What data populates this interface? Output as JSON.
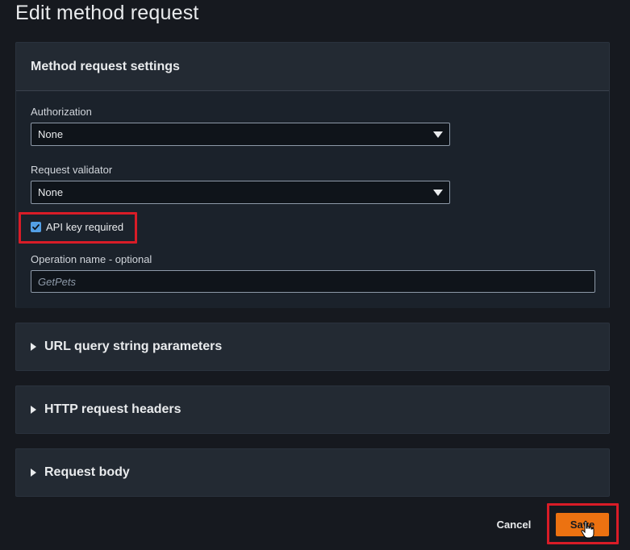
{
  "page": {
    "title": "Edit method request"
  },
  "settings": {
    "title": "Method request settings",
    "authorization": {
      "label": "Authorization",
      "value": "None"
    },
    "validator": {
      "label": "Request validator",
      "value": "None"
    },
    "api_key": {
      "label": "API key required",
      "checked": true
    },
    "operation": {
      "label": "Operation name - optional",
      "placeholder": "GetPets",
      "value": ""
    }
  },
  "sections": [
    {
      "label": "URL query string parameters"
    },
    {
      "label": "HTTP request headers"
    },
    {
      "label": "Request body"
    }
  ],
  "actions": {
    "cancel_label": "Cancel",
    "save_label": "Save"
  },
  "colors": {
    "accent": "#ec7211",
    "highlight": "#d91c27",
    "checkbox": "#539fe5"
  },
  "icons": {
    "select_caret": "caret-down-icon",
    "section_toggle": "caret-right-icon",
    "cursor": "hand-pointer-icon"
  }
}
